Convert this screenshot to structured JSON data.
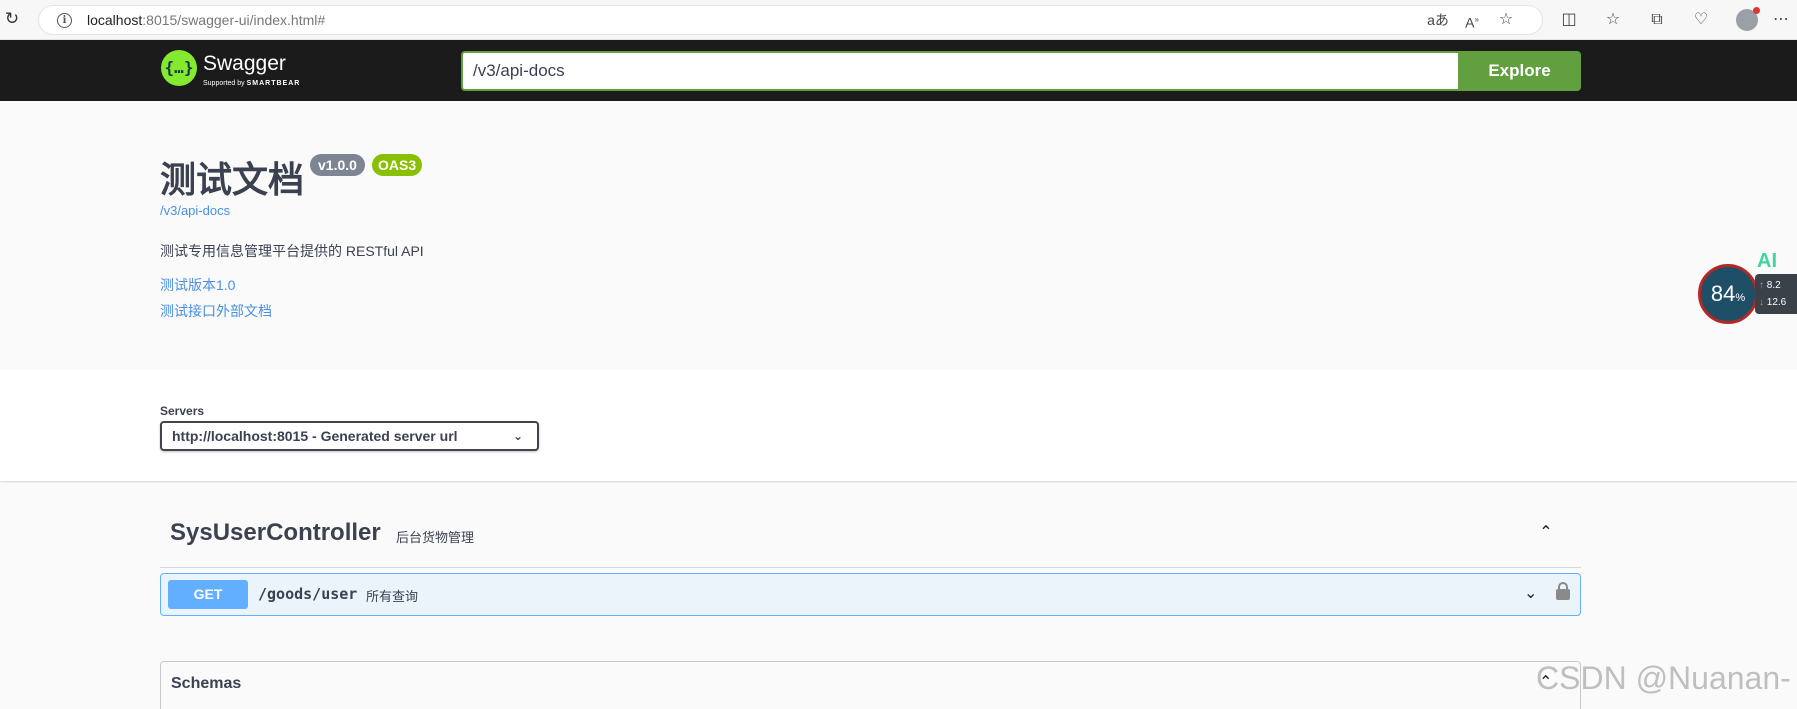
{
  "browser": {
    "url_host": "localhost",
    "url_rest": ":8015/swagger-ui/index.html#"
  },
  "topbar": {
    "logo_name": "Swagger",
    "logo_sub_prefix": "Supported by",
    "logo_sub_brand": "SMARTBEAR",
    "spec_url": "/v3/api-docs",
    "explore_label": "Explore"
  },
  "info": {
    "title": "测试文档",
    "version_badge": "v1.0.0",
    "oas_badge": "OAS3",
    "doc_link": "/v3/api-docs",
    "description": "测试专用信息管理平台提供的 RESTful API",
    "links": [
      "测试版本1.0",
      "测试接口外部文档"
    ]
  },
  "widget": {
    "ai_label": "AI",
    "percent": "84",
    "percent_unit": "%",
    "upload": "8.2",
    "download": "12.6"
  },
  "servers": {
    "label": "Servers",
    "selected": "http://localhost:8015 - Generated server url"
  },
  "operations": {
    "tag_name": "SysUserController",
    "tag_description": "后台货物管理",
    "items": [
      {
        "method": "GET",
        "path": "/goods/user",
        "summary": "所有查询"
      }
    ]
  },
  "models": {
    "title": "Schemas"
  },
  "watermark": "CSDN @Nuanan-"
}
